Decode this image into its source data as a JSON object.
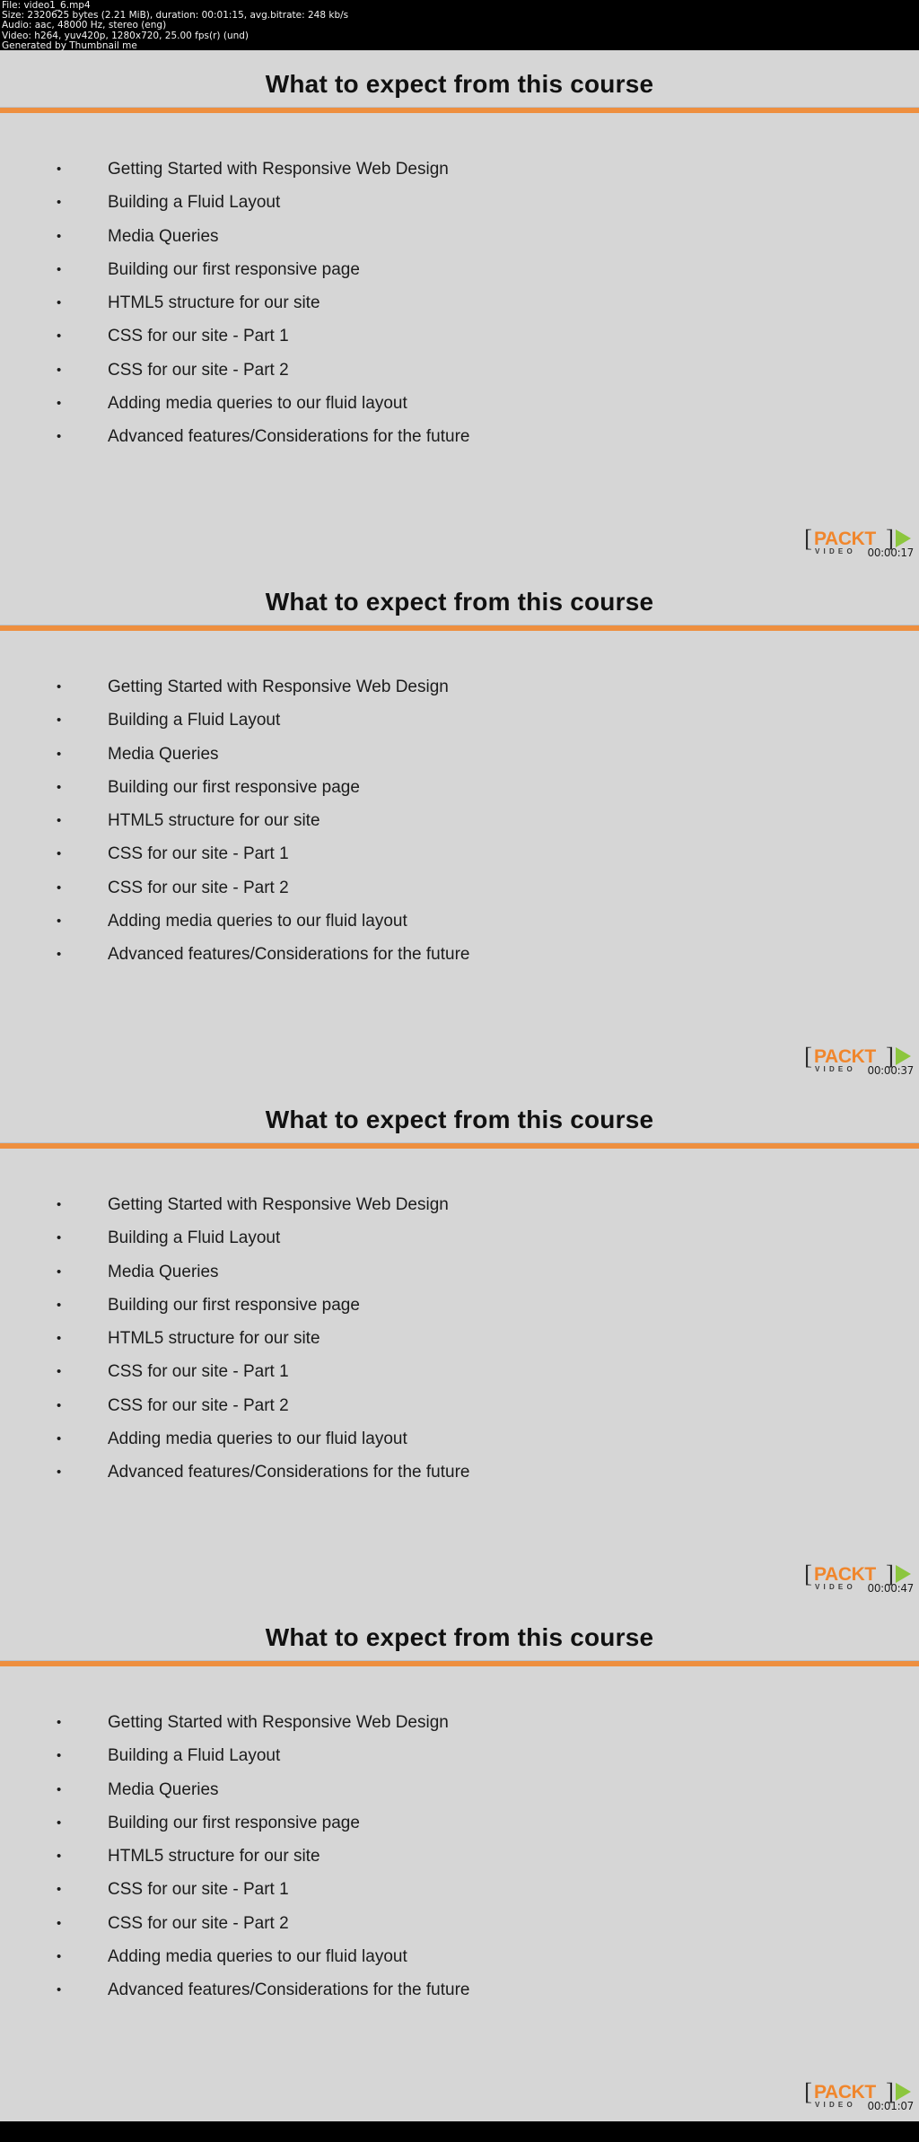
{
  "header": {
    "lines": [
      "File: video1_6.mp4",
      "Size: 2320625 bytes (2.21 MiB), duration: 00:01:15, avg.bitrate: 248 kb/s",
      "Audio: aac, 48000 Hz, stereo (eng)",
      "Video: h264, yuv420p, 1280x720, 25.00 fps(r) (und)",
      "Generated by Thumbnail me"
    ]
  },
  "colors": {
    "header_bg": "#000000",
    "header_text": "#ffffff",
    "slide_bg": "#d6d6d6",
    "accent_orange": "#ee8f3f",
    "logo_orange": "#f0862c",
    "logo_green": "#8cc63e",
    "rule_blue": "#b9c2cc",
    "body_text": "#1b1b1b"
  },
  "slide": {
    "title": "What to expect from this course",
    "bullet_char": "•",
    "bullets": [
      "Getting Started with Responsive Web Design",
      "Building a Fluid Layout",
      "Media Queries",
      "Building our first responsive page",
      "HTML5 structure for our site",
      "CSS for our site - Part 1",
      "CSS for our site - Part 2",
      "Adding media queries to our fluid layout",
      "Advanced features/Considerations for the future"
    ]
  },
  "logo": {
    "bracket_left": "[",
    "bracket_right": "]",
    "word": "PACKT",
    "subtitle": "VIDEO"
  },
  "frames": [
    {
      "timestamp": "00:00:17"
    },
    {
      "timestamp": "00:00:37"
    },
    {
      "timestamp": "00:00:47"
    },
    {
      "timestamp": "00:01:07"
    }
  ]
}
